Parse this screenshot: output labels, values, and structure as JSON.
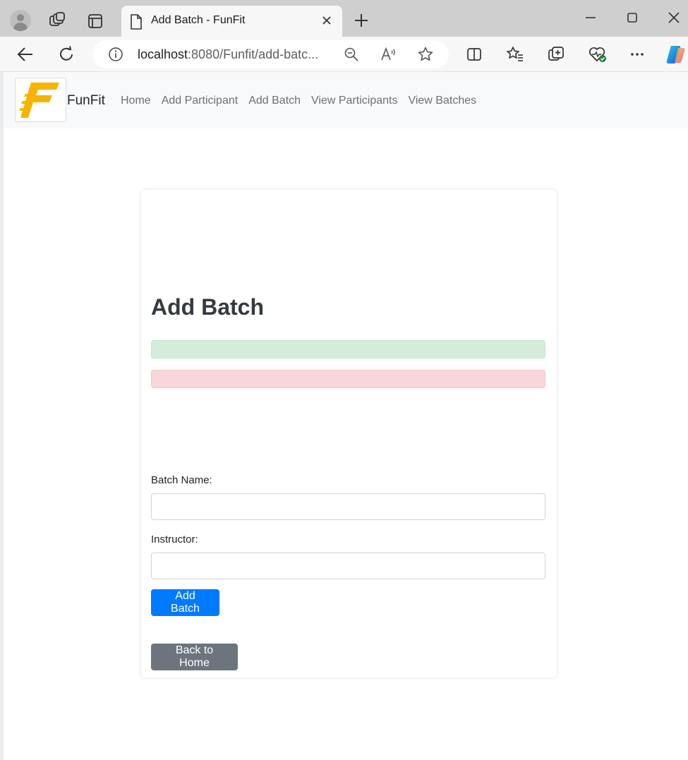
{
  "browser": {
    "tab_title": "Add Batch - FunFit",
    "url_host": "localhost",
    "url_rest": ":8080/Funfit/add-batc...",
    "accent_color": "#0078d4"
  },
  "navbar": {
    "brand": "FunFit",
    "logo_color": "#f6b400",
    "links": [
      "Home",
      "Add Participant",
      "Add Batch",
      "View Participants",
      "View Batches"
    ]
  },
  "form": {
    "title": "Add Batch",
    "success_message": "",
    "error_message": "",
    "batch_name_label": "Batch Name:",
    "batch_name_value": "",
    "instructor_label": "Instructor:",
    "instructor_value": "",
    "submit_label": "Add Batch",
    "back_label": "Back to Home"
  }
}
